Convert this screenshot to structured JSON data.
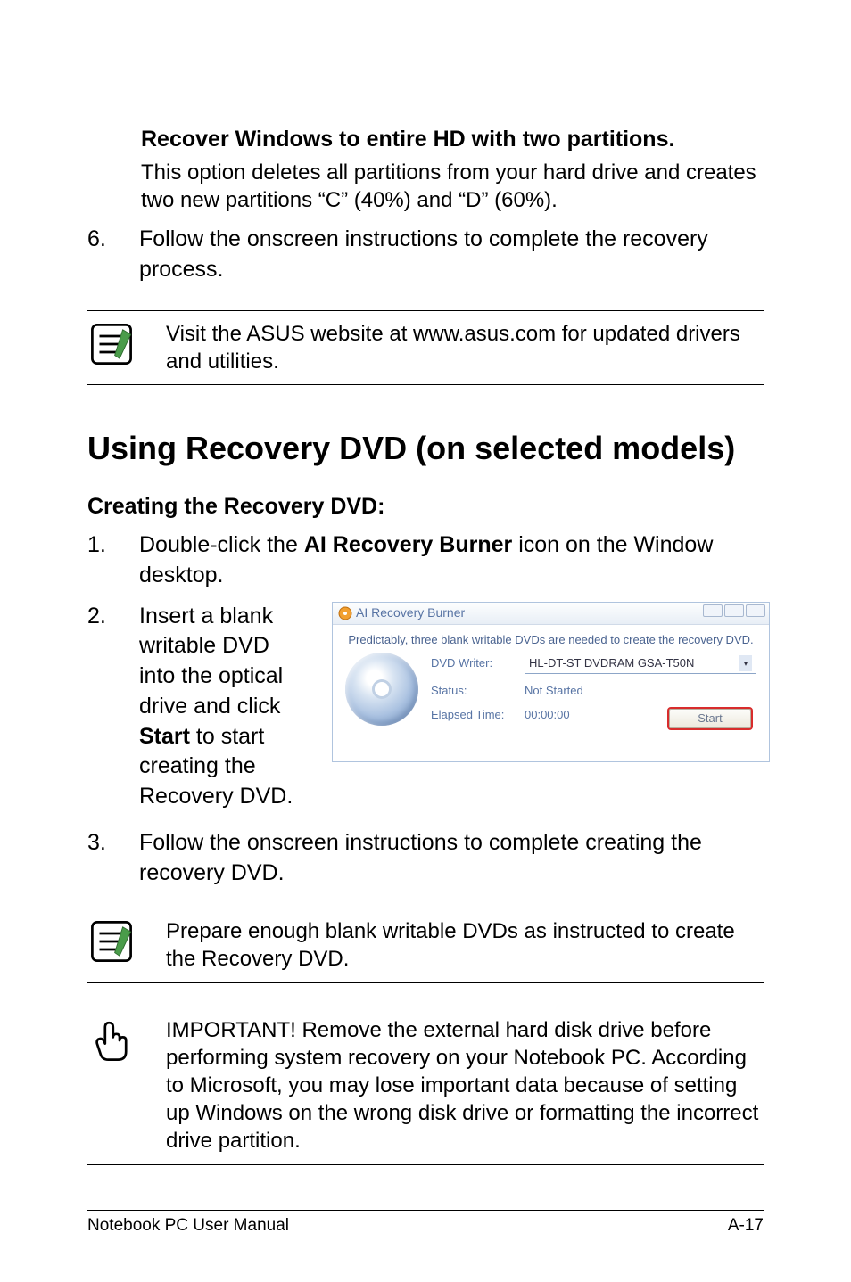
{
  "option_title": "Recover Windows to entire HD with two partitions.",
  "option_desc": "This option deletes all partitions from your hard drive and creates two new partitions “C” (40%) and “D” (60%).",
  "step6_num": "6.",
  "step6_text": "Follow the onscreen instructions to complete the recovery process.",
  "note1": "Visit the ASUS website at www.asus.com for updated drivers and utilities.",
  "section_title": "Using Recovery DVD (on selected models)",
  "sub_title": "Creating the Recovery DVD:",
  "step1_num": "1.",
  "step1_a": "Double-click the ",
  "step1_bold": "AI Recovery Burner",
  "step1_b": " icon on the Window desktop.",
  "step2_num": "2.",
  "step2_a": "Insert a blank writable DVD into the optical drive and click ",
  "step2_bold": "Start",
  "step2_b": " to start creating the Recovery DVD.",
  "ai": {
    "title": "AI Recovery Burner",
    "message": "Predictably, three blank writable DVDs are needed to create the recovery DVD.",
    "writer_label": "DVD Writer:",
    "writer_value": "HL-DT-ST DVDRAM GSA-T50N",
    "status_label": "Status:",
    "status_value": "Not Started",
    "elapsed_label": "Elapsed Time:",
    "elapsed_value": "00:00:00",
    "start_btn": "Start"
  },
  "step3_num": "3.",
  "step3_text": "Follow the onscreen instructions to complete creating the recovery DVD.",
  "note2": "Prepare enough blank writable DVDs as instructed to create the Recovery DVD.",
  "note3": "IMPORTANT! Remove the external hard disk drive before performing system recovery on your Notebook PC. According to Microsoft, you may lose important data because of setting up Windows on the wrong disk drive or formatting the incorrect drive partition.",
  "footer_left": "Notebook PC User Manual",
  "footer_right": "A-17"
}
